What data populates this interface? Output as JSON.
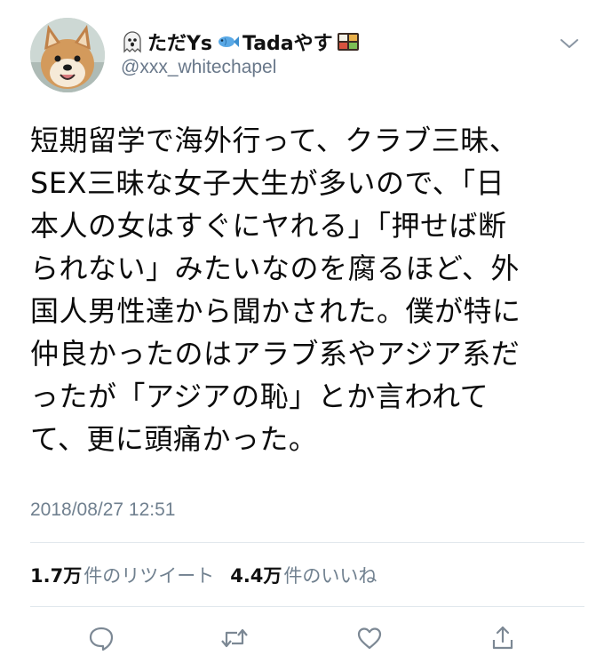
{
  "user": {
    "name_part1": "ただYs",
    "name_part2": "Tadaやす",
    "handle": "@xxx_whitechapel",
    "avatar": "shiba-dog-avatar"
  },
  "tweet": {
    "lines": [
      "短期留学で海外行って、クラブ三昧、",
      "SEX三昧な女子大生が多いので、「日",
      "本人の女はすぐにヤれる」「押せば断",
      "られない」みたいなのを腐るほど、外",
      "国人男性達から聞かされた。僕が特に",
      "仲良かったのはアラブ系やアジア系だ",
      "ったが「アジアの恥」とか言われて",
      "て、更に頭痛かった。"
    ],
    "timestamp": "2018/08/27 12:51"
  },
  "stats": {
    "retweets_count": "1.7万",
    "retweets_label": "件のリツイート",
    "likes_count": "4.4万",
    "likes_label": "件のいいね"
  },
  "icons": {
    "name_emojis": [
      "ghost-icon",
      "fish-icon",
      "bento-icon"
    ],
    "menu": "chevron-down-icon",
    "actions": [
      "reply-icon",
      "retweet-icon",
      "like-icon",
      "share-icon"
    ]
  },
  "colors": {
    "secondary_text": "#70808f",
    "icon_gray": "#7c8894",
    "divider": "#e1e8ed"
  }
}
